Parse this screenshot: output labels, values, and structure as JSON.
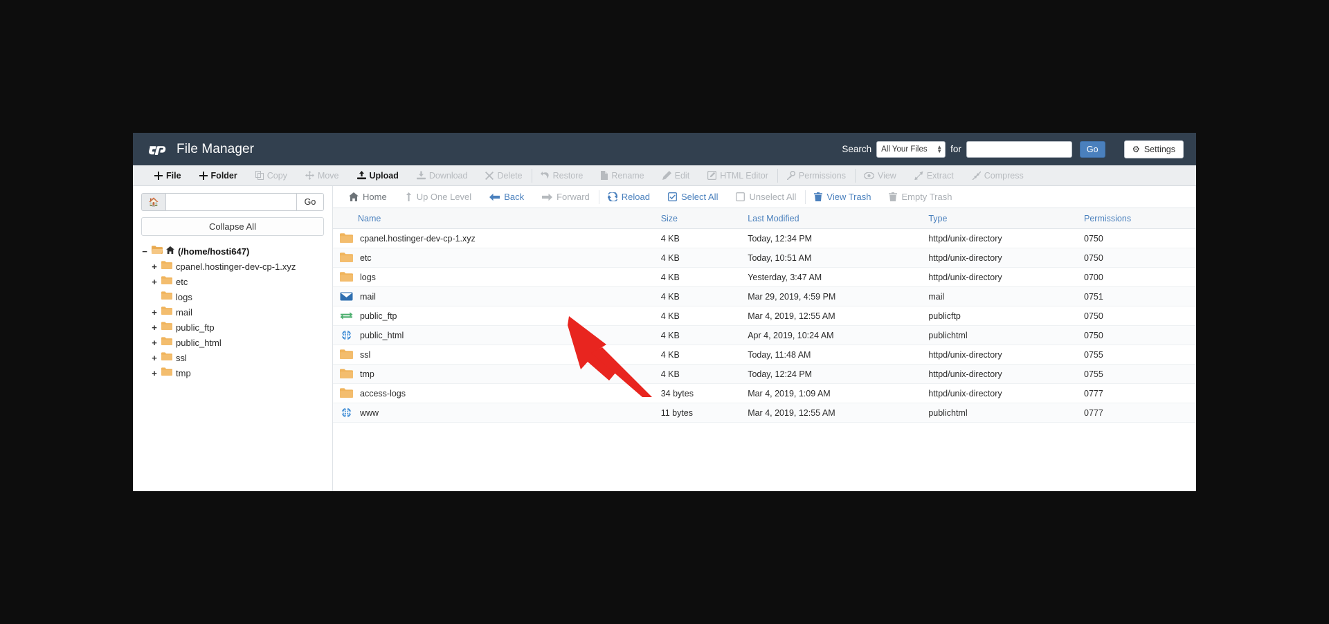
{
  "header": {
    "title": "File Manager",
    "logo_icon": "cpanel-logo-icon",
    "search_label": "Search",
    "search_scope_value": "All Your Files",
    "search_scope_options": [
      "All Your Files"
    ],
    "for_label": "for",
    "search_value": "",
    "search_placeholder": "",
    "go_label": "Go",
    "settings_label": "Settings",
    "settings_icon": "gear-icon",
    "accent_color": "#4a80bd",
    "header_bg": "#32404f"
  },
  "action_toolbar": [
    {
      "label": "File",
      "icon": "plus-icon",
      "enabled": true
    },
    {
      "label": "Folder",
      "icon": "plus-icon",
      "enabled": true
    },
    {
      "label": "Copy",
      "icon": "copy-icon",
      "enabled": false
    },
    {
      "label": "Move",
      "icon": "move-arrows-icon",
      "enabled": false
    },
    {
      "label": "Upload",
      "icon": "upload-icon",
      "enabled": true
    },
    {
      "label": "Download",
      "icon": "download-icon",
      "enabled": false
    },
    {
      "label": "Delete",
      "icon": "x-icon",
      "enabled": false
    },
    {
      "label": "Restore",
      "icon": "undo-icon",
      "enabled": false
    },
    {
      "label": "Rename",
      "icon": "file-icon",
      "enabled": false
    },
    {
      "label": "Edit",
      "icon": "pencil-icon",
      "enabled": false
    },
    {
      "label": "HTML Editor",
      "icon": "html-edit-icon",
      "enabled": false
    },
    {
      "label": "Permissions",
      "icon": "key-icon",
      "enabled": false
    },
    {
      "label": "View",
      "icon": "eye-icon",
      "enabled": false
    },
    {
      "label": "Extract",
      "icon": "extract-icon",
      "enabled": false
    },
    {
      "label": "Compress",
      "icon": "compress-icon",
      "enabled": false
    }
  ],
  "sidebar": {
    "home_icon": "home-icon",
    "path_value": "",
    "path_placeholder": "",
    "go_label": "Go",
    "collapse_all_label": "Collapse All",
    "tree": [
      {
        "label": "(/home/hosti647)",
        "toggle": "minus",
        "indent": 0,
        "icon": "folder-open-icon",
        "home": true
      },
      {
        "label": "cpanel.hostinger-dev-cp-1.xyz",
        "toggle": "plus",
        "indent": 1,
        "icon": "folder-icon",
        "home": false
      },
      {
        "label": "etc",
        "toggle": "plus",
        "indent": 1,
        "icon": "folder-icon",
        "home": false
      },
      {
        "label": "logs",
        "toggle": "none",
        "indent": 1,
        "icon": "folder-icon",
        "home": false
      },
      {
        "label": "mail",
        "toggle": "plus",
        "indent": 1,
        "icon": "folder-icon",
        "home": false
      },
      {
        "label": "public_ftp",
        "toggle": "plus",
        "indent": 1,
        "icon": "folder-icon",
        "home": false
      },
      {
        "label": "public_html",
        "toggle": "plus",
        "indent": 1,
        "icon": "folder-icon",
        "home": false
      },
      {
        "label": "ssl",
        "toggle": "plus",
        "indent": 1,
        "icon": "folder-icon",
        "home": false
      },
      {
        "label": "tmp",
        "toggle": "plus",
        "indent": 1,
        "icon": "folder-icon",
        "home": false
      }
    ]
  },
  "nav_toolbar": [
    {
      "label": "Home",
      "icon": "home-icon",
      "style": "dark"
    },
    {
      "label": "Up One Level",
      "icon": "up-arrow-icon",
      "style": "muted"
    },
    {
      "label": "Back",
      "icon": "arrow-left-icon",
      "style": "active"
    },
    {
      "label": "Forward",
      "icon": "arrow-right-icon",
      "style": "muted"
    },
    {
      "label": "Reload",
      "icon": "reload-icon",
      "style": "active"
    },
    {
      "label": "Select All",
      "icon": "checkbox-checked-icon",
      "style": "active"
    },
    {
      "label": "Unselect All",
      "icon": "checkbox-empty-icon",
      "style": "muted"
    },
    {
      "label": "View Trash",
      "icon": "trash-icon",
      "style": "active"
    },
    {
      "label": "Empty Trash",
      "icon": "trash-icon",
      "style": "muted"
    }
  ],
  "table": {
    "columns": [
      "Name",
      "Size",
      "Last Modified",
      "Type",
      "Permissions"
    ],
    "rows": [
      {
        "icon": "folder-icon",
        "name": "cpanel.hostinger-dev-cp-1.xyz",
        "size": "4 KB",
        "modified": "Today, 12:34 PM",
        "type": "httpd/unix-directory",
        "permissions": "0750"
      },
      {
        "icon": "folder-icon",
        "name": "etc",
        "size": "4 KB",
        "modified": "Today, 10:51 AM",
        "type": "httpd/unix-directory",
        "permissions": "0750"
      },
      {
        "icon": "folder-icon",
        "name": "logs",
        "size": "4 KB",
        "modified": "Yesterday, 3:47 AM",
        "type": "httpd/unix-directory",
        "permissions": "0700"
      },
      {
        "icon": "mail-icon",
        "name": "mail",
        "size": "4 KB",
        "modified": "Mar 29, 2019, 4:59 PM",
        "type": "mail",
        "permissions": "0751"
      },
      {
        "icon": "ftp-icon",
        "name": "public_ftp",
        "size": "4 KB",
        "modified": "Mar 4, 2019, 12:55 AM",
        "type": "publicftp",
        "permissions": "0750"
      },
      {
        "icon": "globe-icon",
        "name": "public_html",
        "size": "4 KB",
        "modified": "Apr 4, 2019, 10:24 AM",
        "type": "publichtml",
        "permissions": "0750"
      },
      {
        "icon": "folder-icon",
        "name": "ssl",
        "size": "4 KB",
        "modified": "Today, 11:48 AM",
        "type": "httpd/unix-directory",
        "permissions": "0755"
      },
      {
        "icon": "folder-icon",
        "name": "tmp",
        "size": "4 KB",
        "modified": "Today, 12:24 PM",
        "type": "httpd/unix-directory",
        "permissions": "0755"
      },
      {
        "icon": "folder-icon",
        "name": "access-logs",
        "size": "34 bytes",
        "modified": "Mar 4, 2019, 1:09 AM",
        "type": "httpd/unix-directory",
        "permissions": "0777"
      },
      {
        "icon": "globe-icon",
        "name": "www",
        "size": "11 bytes",
        "modified": "Mar 4, 2019, 12:55 AM",
        "type": "publichtml",
        "permissions": "0777"
      }
    ]
  },
  "annotation": {
    "arrow_icon": "red-arrow-icon",
    "color": "#e8251f",
    "points_at": "Download"
  }
}
